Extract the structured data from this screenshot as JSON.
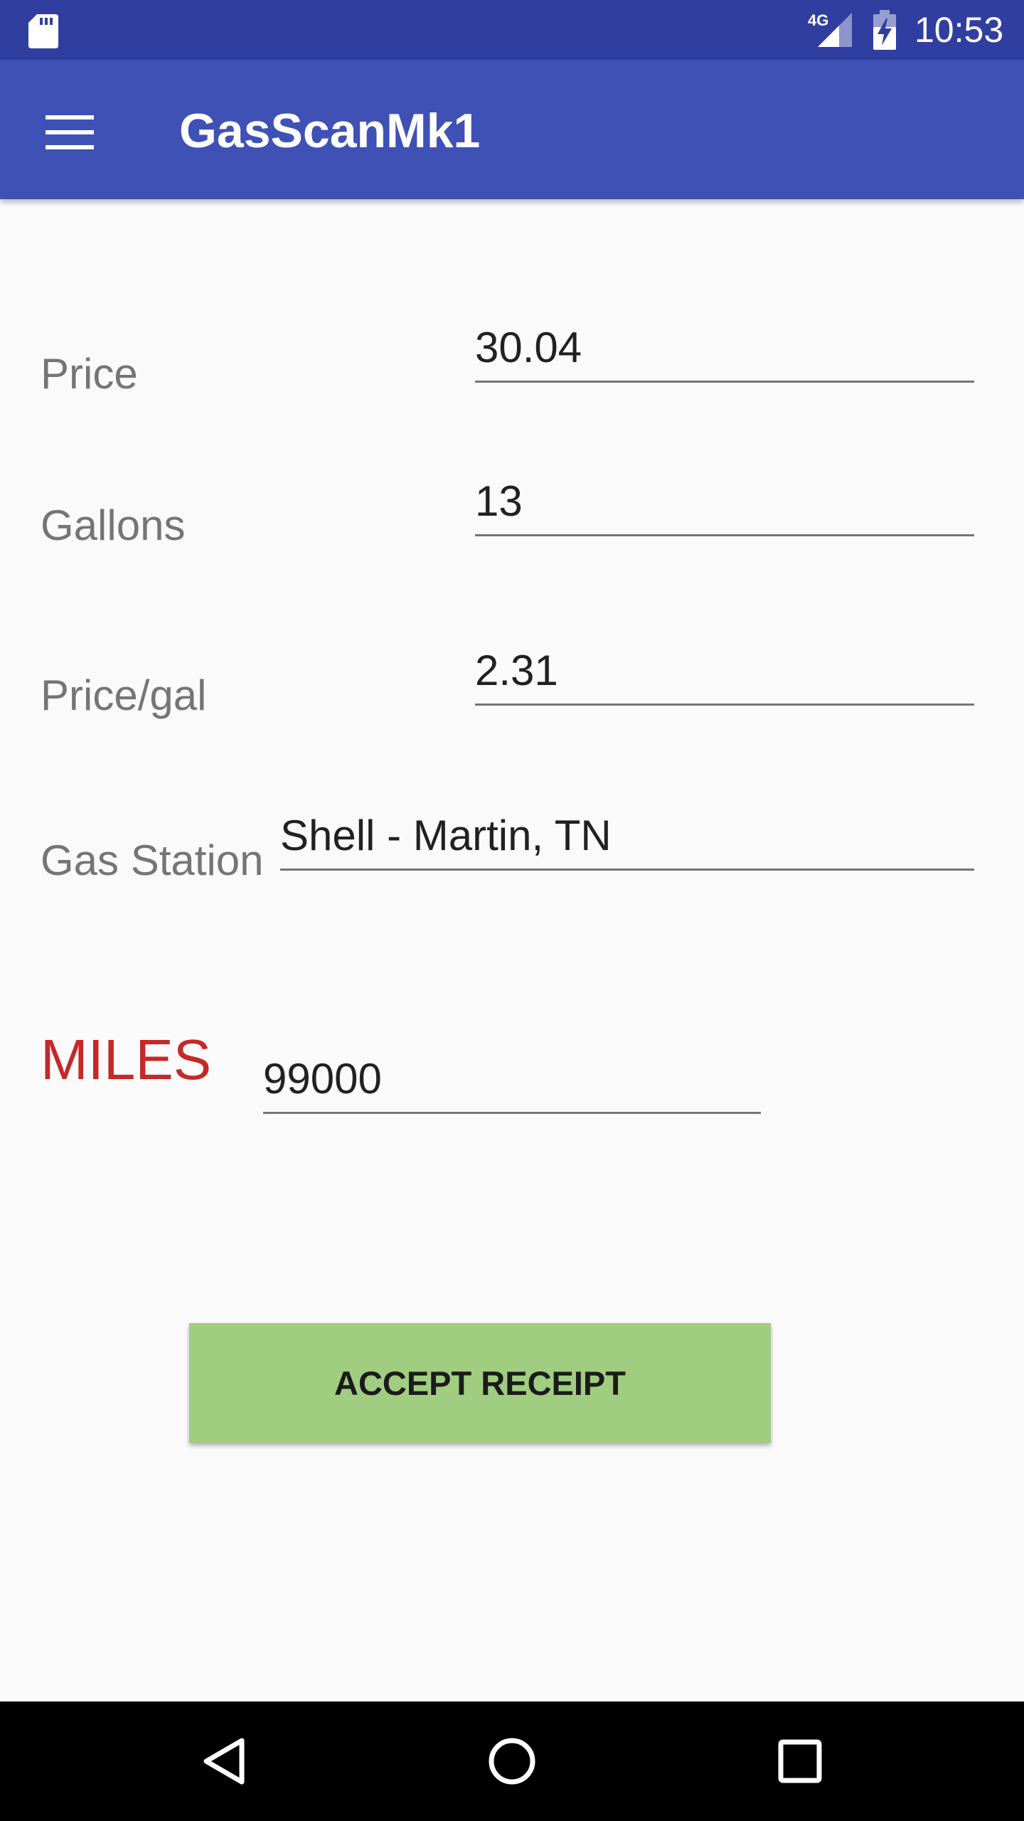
{
  "status_bar": {
    "network_label": "4G",
    "time": "10:53",
    "icons": [
      "sd-card-icon",
      "cell-signal-icon",
      "battery-charging-icon"
    ]
  },
  "app_bar": {
    "title": "GasScanMk1",
    "menu_icon": "hamburger-menu-icon"
  },
  "form": {
    "price": {
      "label": "Price",
      "value": "30.04"
    },
    "gallons": {
      "label": "Gallons",
      "value": "13"
    },
    "price_per_gal": {
      "label": "Price/gal",
      "value": "2.31"
    },
    "gas_station": {
      "label": "Gas Station",
      "value": "Shell - Martin, TN"
    },
    "miles": {
      "label": "MILES",
      "value": "99000"
    }
  },
  "accept_button": {
    "label": "ACCEPT RECEIPT"
  },
  "nav_bar": {
    "icons": [
      "back-icon",
      "home-icon",
      "recents-icon"
    ]
  },
  "colors": {
    "status_bar": "#303f9f",
    "app_bar": "#3f51b5",
    "background": "#fafafa",
    "miles_label": "#c62828",
    "accept_button": "#a0cd80",
    "label_text": "#757575",
    "input_text": "#212121"
  }
}
